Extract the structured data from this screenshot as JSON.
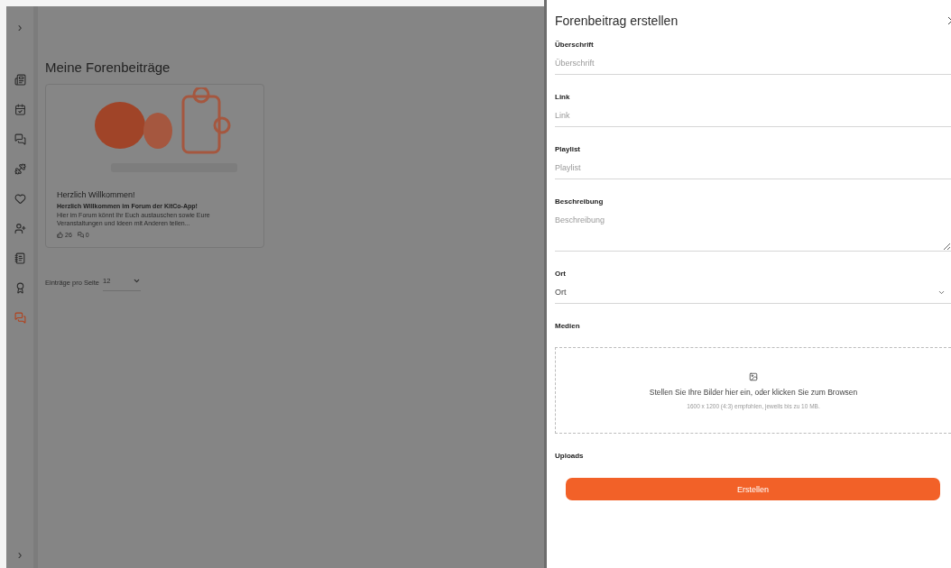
{
  "sidebar": {
    "expand_top": "›",
    "items": [
      {
        "selected": false
      },
      {
        "selected": false
      },
      {
        "selected": false
      },
      {
        "selected": false
      },
      {
        "selected": false
      },
      {
        "selected": false
      },
      {
        "selected": false
      },
      {
        "selected": false
      },
      {
        "selected": true
      }
    ],
    "expand_bottom": "›"
  },
  "page": {
    "title": "Meine Forenbeiträge",
    "posts": [
      {
        "title": "Herzlich Willkommen!",
        "subtitle": "Herzlich Willkommen im Forum der KitCo-App!",
        "excerpt": "Hier im Forum könnt Ihr Euch austauschen sowie Eure Veranstaltungen und Ideen mit Anderen teilen...",
        "likes": "26",
        "comments": "0"
      }
    ],
    "pagination": {
      "label": "Einträge pro Seite",
      "value": "12"
    }
  },
  "drawer": {
    "title": "Forenbeitrag erstellen",
    "fields": [
      {
        "kind": "text",
        "label": "Überschrift",
        "placeholder": "Überschrift"
      },
      {
        "kind": "text",
        "label": "Link",
        "placeholder": "Link"
      },
      {
        "kind": "text",
        "label": "Playlist",
        "placeholder": "Playlist"
      },
      {
        "kind": "textarea",
        "label": "Beschreibung",
        "placeholder": "Beschreibung"
      },
      {
        "kind": "select",
        "label": "Ort",
        "value": "Ort"
      }
    ],
    "media": {
      "label": "Medien",
      "prompt": "Stellen Sie Ihre Bilder hier ein, oder klicken Sie zum Browsen",
      "hint": "1600 x 1200 (4:3) empfohlen, jeweils bis zu 10 MB."
    },
    "uploads_label": "Uploads",
    "submit": "Erstellen"
  }
}
